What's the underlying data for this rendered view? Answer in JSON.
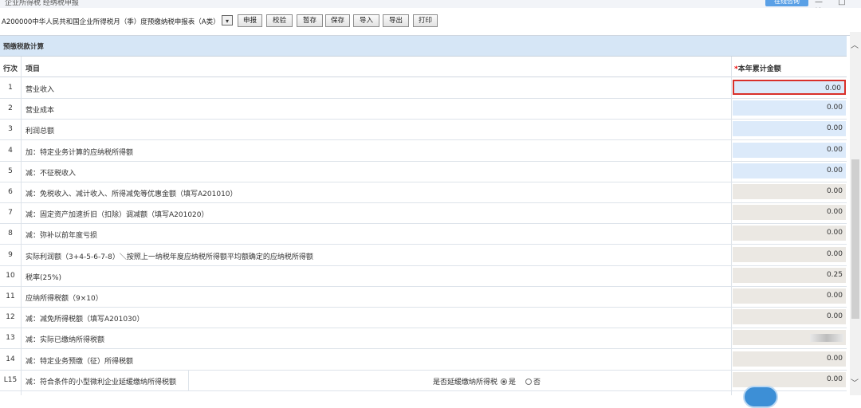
{
  "window": {
    "title": "企业所得税  经纳税申报",
    "online_button": "在线咨询",
    "controls": "— □ ✕"
  },
  "toolbar": {
    "form_name": "A200000中华人民共和国企业所得税月（季）度预缴纳税申报表（A类）",
    "dropdown_arrow": "▾",
    "buttons": [
      "申报",
      "校验",
      "暂存",
      "保存",
      "导入",
      "导出",
      "打印"
    ]
  },
  "section_title": "预缴税款计算",
  "table": {
    "headers": {
      "row_no": "行次",
      "item": "项目",
      "amount_required_mark": "*",
      "amount": "本年累计金额"
    },
    "rows": [
      {
        "no": "1",
        "item": "营业收入",
        "value": "0.00",
        "style": "blue",
        "highlighted": true
      },
      {
        "no": "2",
        "item": "营业成本",
        "value": "0.00",
        "style": "blue"
      },
      {
        "no": "3",
        "item": "利润总额",
        "value": "0.00",
        "style": "blue"
      },
      {
        "no": "4",
        "item": "加：特定业务计算的应纳税所得额",
        "value": "0.00",
        "style": "blue"
      },
      {
        "no": "5",
        "item": "减：不征税收入",
        "value": "0.00",
        "style": "blue"
      },
      {
        "no": "6",
        "item": "减：免税收入、减计收入、所得减免等优惠金额（填写A201010）",
        "value": "0.00",
        "style": "grey"
      },
      {
        "no": "7",
        "item": "减：固定资产加速折旧（扣除）调减额（填写A201020）",
        "value": "0.00",
        "style": "grey"
      },
      {
        "no": "8",
        "item": "减：弥补以前年度亏损",
        "value": "0.00",
        "style": "grey"
      },
      {
        "no": "9",
        "item": "实际利润额（3+4-5-6-7-8）＼按照上一纳税年度应纳税所得额平均额确定的应纳税所得额",
        "value": "0.00",
        "style": "grey"
      },
      {
        "no": "10",
        "item": "税率(25%)",
        "value": "0.25",
        "style": "grey"
      },
      {
        "no": "11",
        "item": "应纳所得税额（9×10）",
        "value": "0.00",
        "style": "grey"
      },
      {
        "no": "12",
        "item": "减：减免所得税额（填写A201030）",
        "value": "0.00",
        "style": "grey"
      },
      {
        "no": "13",
        "item": "减：实际已缴纳所得税额",
        "value": "",
        "style": "grey",
        "blurred": true
      },
      {
        "no": "14",
        "item": "减：特定业务预缴（征）所得税额",
        "value": "0.00",
        "style": "grey"
      },
      {
        "no": "L15",
        "item": "减：符合条件的小型微利企业延缓缴纳所得税额",
        "value": "0.00",
        "style": "grey",
        "extra_label": "是否延缓缴纳所得税",
        "option_yes": "是",
        "option_no": "否",
        "selected": "yes"
      }
    ]
  },
  "scrollbar": {
    "up": "︿",
    "down": "﹀"
  }
}
